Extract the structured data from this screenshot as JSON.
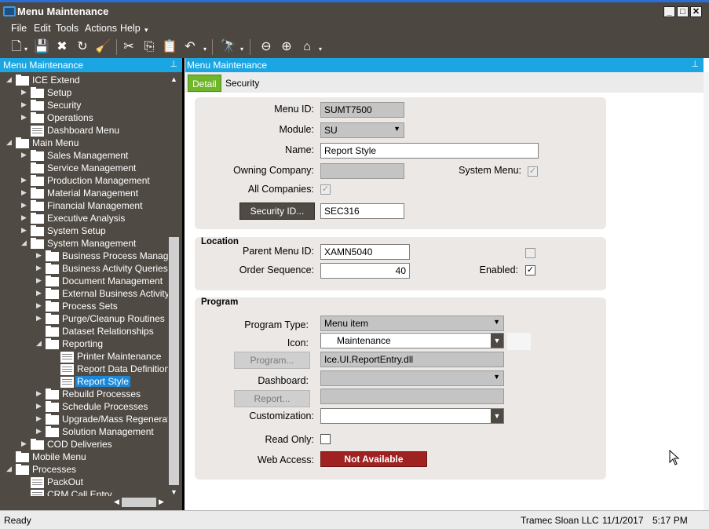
{
  "window": {
    "title": "Menu Maintenance"
  },
  "menubar": {
    "items": [
      "File",
      "Edit",
      "Tools",
      "Actions",
      "Help"
    ]
  },
  "left_panel": {
    "title": "Menu Maintenance"
  },
  "tree": [
    {
      "label": "ICE Extend",
      "level": 0,
      "type": "folder",
      "state": "open"
    },
    {
      "label": "Setup",
      "level": 1,
      "type": "folder",
      "state": "closed"
    },
    {
      "label": "Security",
      "level": 1,
      "type": "folder",
      "state": "closed"
    },
    {
      "label": "Operations",
      "level": 1,
      "type": "folder",
      "state": "closed"
    },
    {
      "label": "Dashboard Menu",
      "level": 1,
      "type": "doc",
      "state": "none"
    },
    {
      "label": "Main Menu",
      "level": 0,
      "type": "folder",
      "state": "open"
    },
    {
      "label": "Sales Management",
      "level": 1,
      "type": "folder",
      "state": "closed"
    },
    {
      "label": "Service Management",
      "level": 1,
      "type": "folder",
      "state": "none"
    },
    {
      "label": "Production Management",
      "level": 1,
      "type": "folder",
      "state": "closed"
    },
    {
      "label": "Material Management",
      "level": 1,
      "type": "folder",
      "state": "closed"
    },
    {
      "label": "Financial Management",
      "level": 1,
      "type": "folder",
      "state": "closed"
    },
    {
      "label": "Executive Analysis",
      "level": 1,
      "type": "folder",
      "state": "closed"
    },
    {
      "label": "System Setup",
      "level": 1,
      "type": "folder",
      "state": "closed"
    },
    {
      "label": "System Management",
      "level": 1,
      "type": "folder",
      "state": "open"
    },
    {
      "label": "Business Process Manag",
      "level": 2,
      "type": "folder",
      "state": "closed"
    },
    {
      "label": "Business Activity Queries",
      "level": 2,
      "type": "folder",
      "state": "closed"
    },
    {
      "label": "Document Management",
      "level": 2,
      "type": "folder",
      "state": "closed"
    },
    {
      "label": "External Business Activity",
      "level": 2,
      "type": "folder",
      "state": "closed"
    },
    {
      "label": "Process Sets",
      "level": 2,
      "type": "folder",
      "state": "closed"
    },
    {
      "label": "Purge/Cleanup Routines",
      "level": 2,
      "type": "folder",
      "state": "closed"
    },
    {
      "label": "Dataset Relationships",
      "level": 2,
      "type": "folder",
      "state": "none"
    },
    {
      "label": "Reporting",
      "level": 2,
      "type": "folder",
      "state": "open"
    },
    {
      "label": "Printer Maintenance",
      "level": 3,
      "type": "doc",
      "state": "none"
    },
    {
      "label": "Report Data Definition",
      "level": 3,
      "type": "doc",
      "state": "none"
    },
    {
      "label": "Report Style",
      "level": 3,
      "type": "doc",
      "state": "none",
      "selected": true
    },
    {
      "label": "Rebuild Processes",
      "level": 2,
      "type": "folder",
      "state": "closed"
    },
    {
      "label": "Schedule Processes",
      "level": 2,
      "type": "folder",
      "state": "closed"
    },
    {
      "label": "Upgrade/Mass Regenerati",
      "level": 2,
      "type": "folder",
      "state": "closed"
    },
    {
      "label": "Solution Management",
      "level": 2,
      "type": "folder",
      "state": "closed"
    },
    {
      "label": "COD Deliveries",
      "level": 1,
      "type": "folder",
      "state": "closed"
    },
    {
      "label": "Mobile Menu",
      "level": 0,
      "type": "folder",
      "state": "none"
    },
    {
      "label": "Processes",
      "level": 0,
      "type": "folder",
      "state": "open"
    },
    {
      "label": "PackOut",
      "level": 1,
      "type": "doc",
      "state": "none"
    },
    {
      "label": "CRM Call Entry",
      "level": 1,
      "type": "doc",
      "state": "none"
    }
  ],
  "right_panel": {
    "title": "Menu Maintenance"
  },
  "tabs": [
    "Detail",
    "Security"
  ],
  "detail": {
    "menu_id_label": "Menu ID:",
    "menu_id": "SUMT7500",
    "module_label": "Module:",
    "module": "SU",
    "name_label": "Name:",
    "name": "Report Style",
    "owning_company_label": "Owning Company:",
    "owning_company": "",
    "system_menu_label": "System Menu:",
    "system_menu_checked": "✓",
    "all_companies_label": "All Companies:",
    "all_companies_checked": "✓",
    "security_id_button": "Security ID...",
    "security_id": "SEC316"
  },
  "location": {
    "title": "Location",
    "parent_menu_id_label": "Parent Menu ID:",
    "parent_menu_id": "XAMN5040",
    "order_sequence_label": "Order Sequence:",
    "order_sequence": "40",
    "enabled_label": "Enabled:",
    "enabled_checked": "✓"
  },
  "program": {
    "title": "Program",
    "program_type_label": "Program Type:",
    "program_type": "Menu item",
    "icon_label": "Icon:",
    "icon": "Maintenance",
    "program_button": "Program...",
    "program_value": "Ice.UI.ReportEntry.dll",
    "dashboard_label": "Dashboard:",
    "dashboard": "",
    "report_button": "Report...",
    "report_value": "",
    "customization_label": "Customization:",
    "customization": "",
    "read_only_label": "Read Only:",
    "web_access_label": "Web Access:",
    "web_access": "Not Available"
  },
  "statusbar": {
    "status": "Ready",
    "company": "Tramec Sloan LLC",
    "date": "11/1/2017",
    "time": "5:17 PM"
  },
  "colors": {
    "header_blue": "#1ba6e3",
    "dark_chrome": "#4d4741",
    "tab_active": "#6fb62a",
    "not_available": "#9f2220"
  }
}
